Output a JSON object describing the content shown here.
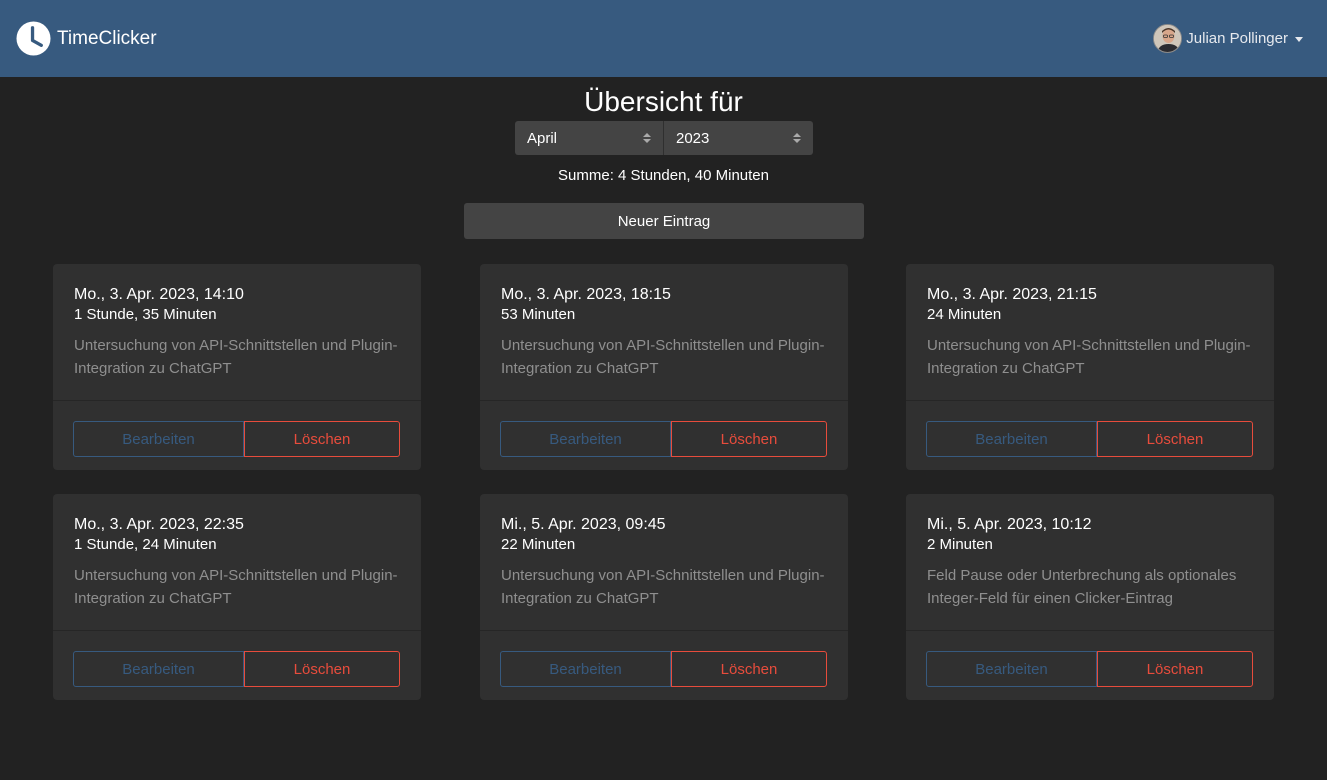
{
  "app": {
    "name": "TimeClicker",
    "user_name": "Julian Pollinger"
  },
  "overview": {
    "title": "Übersicht für",
    "month": "April",
    "year": "2023",
    "summary": "Summe: 4 Stunden, 40 Minuten",
    "new_entry_label": "Neuer Eintrag"
  },
  "entries": [
    {
      "date": "Mo., 3. Apr. 2023, 14:10",
      "duration": "1 Stunde, 35 Minuten",
      "description": "Untersuchung von API-Schnittstellen und Plugin-Integration zu ChatGPT",
      "edit_label": "Bearbeiten",
      "delete_label": "Löschen"
    },
    {
      "date": "Mo., 3. Apr. 2023, 18:15",
      "duration": "53 Minuten",
      "description": "Untersuchung von API-Schnittstellen und Plugin-Integration zu ChatGPT",
      "edit_label": "Bearbeiten",
      "delete_label": "Löschen"
    },
    {
      "date": "Mo., 3. Apr. 2023, 21:15",
      "duration": "24 Minuten",
      "description": "Untersuchung von API-Schnittstellen und Plugin-Integration zu ChatGPT",
      "edit_label": "Bearbeiten",
      "delete_label": "Löschen"
    },
    {
      "date": "Mo., 3. Apr. 2023, 22:35",
      "duration": "1 Stunde, 24 Minuten",
      "description": "Untersuchung von API-Schnittstellen und Plugin-Integration zu ChatGPT",
      "edit_label": "Bearbeiten",
      "delete_label": "Löschen"
    },
    {
      "date": "Mi., 5. Apr. 2023, 09:45",
      "duration": "22 Minuten",
      "description": "Untersuchung von API-Schnittstellen und Plugin-Integration zu ChatGPT",
      "edit_label": "Bearbeiten",
      "delete_label": "Löschen"
    },
    {
      "date": "Mi., 5. Apr. 2023, 10:12",
      "duration": "2 Minuten",
      "description": "Feld Pause oder Unterbrechung als optionales Integer-Feld für einen Clicker-Eintrag",
      "edit_label": "Bearbeiten",
      "delete_label": "Löschen"
    }
  ],
  "colors": {
    "navbar": "#375a7f",
    "background": "#222222",
    "card": "#303030",
    "primary": "#375a7f",
    "danger": "#e74c3c",
    "muted_text": "#8f8f8f"
  },
  "icons": {
    "brand": "clock-icon",
    "user_avatar": "avatar",
    "user_menu": "caret-down-icon"
  }
}
